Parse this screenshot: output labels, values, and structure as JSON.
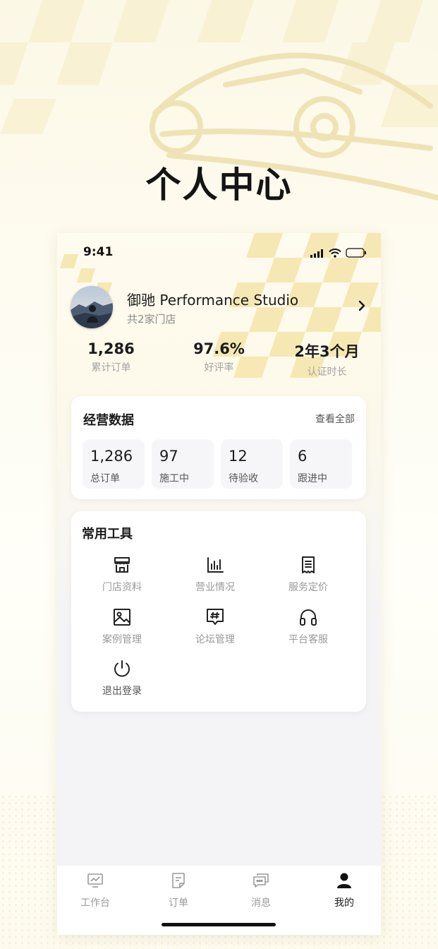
{
  "page_title": "个人中心",
  "status_bar": {
    "time": "9:41"
  },
  "profile": {
    "store_name": "御驰 Performance Studio",
    "store_count": "共2家门店"
  },
  "stats": [
    {
      "value": "1,286",
      "label": "累计订单"
    },
    {
      "value": "97.6%",
      "label": "好评率"
    },
    {
      "value": "2年3个月",
      "label": "认证时长"
    }
  ],
  "business": {
    "title": "经营数据",
    "view_all": "查看全部",
    "tiles": [
      {
        "value": "1,286",
        "label": "总订单"
      },
      {
        "value": "97",
        "label": "施工中"
      },
      {
        "value": "12",
        "label": "待验收"
      },
      {
        "value": "6",
        "label": "跟进中"
      }
    ]
  },
  "tools": {
    "title": "常用工具",
    "items": [
      {
        "label": "门店资料",
        "icon": "store-icon"
      },
      {
        "label": "营业情况",
        "icon": "bar-chart-icon"
      },
      {
        "label": "服务定价",
        "icon": "price-list-icon"
      },
      {
        "label": "案例管理",
        "icon": "image-icon"
      },
      {
        "label": "论坛管理",
        "icon": "forum-icon"
      },
      {
        "label": "平台客服",
        "icon": "headset-icon"
      },
      {
        "label": "退出登录",
        "icon": "power-icon"
      }
    ]
  },
  "tabbar": [
    {
      "label": "工作台",
      "icon": "workbench-icon",
      "active": false
    },
    {
      "label": "订单",
      "icon": "order-icon",
      "active": false
    },
    {
      "label": "消息",
      "icon": "message-icon",
      "active": false
    },
    {
      "label": "我的",
      "icon": "user-icon",
      "active": true
    }
  ],
  "colors": {
    "accent": "#f2dc8e",
    "background": "#fdfbef",
    "text": "#1c1c1c",
    "muted": "#9a9a9a"
  }
}
